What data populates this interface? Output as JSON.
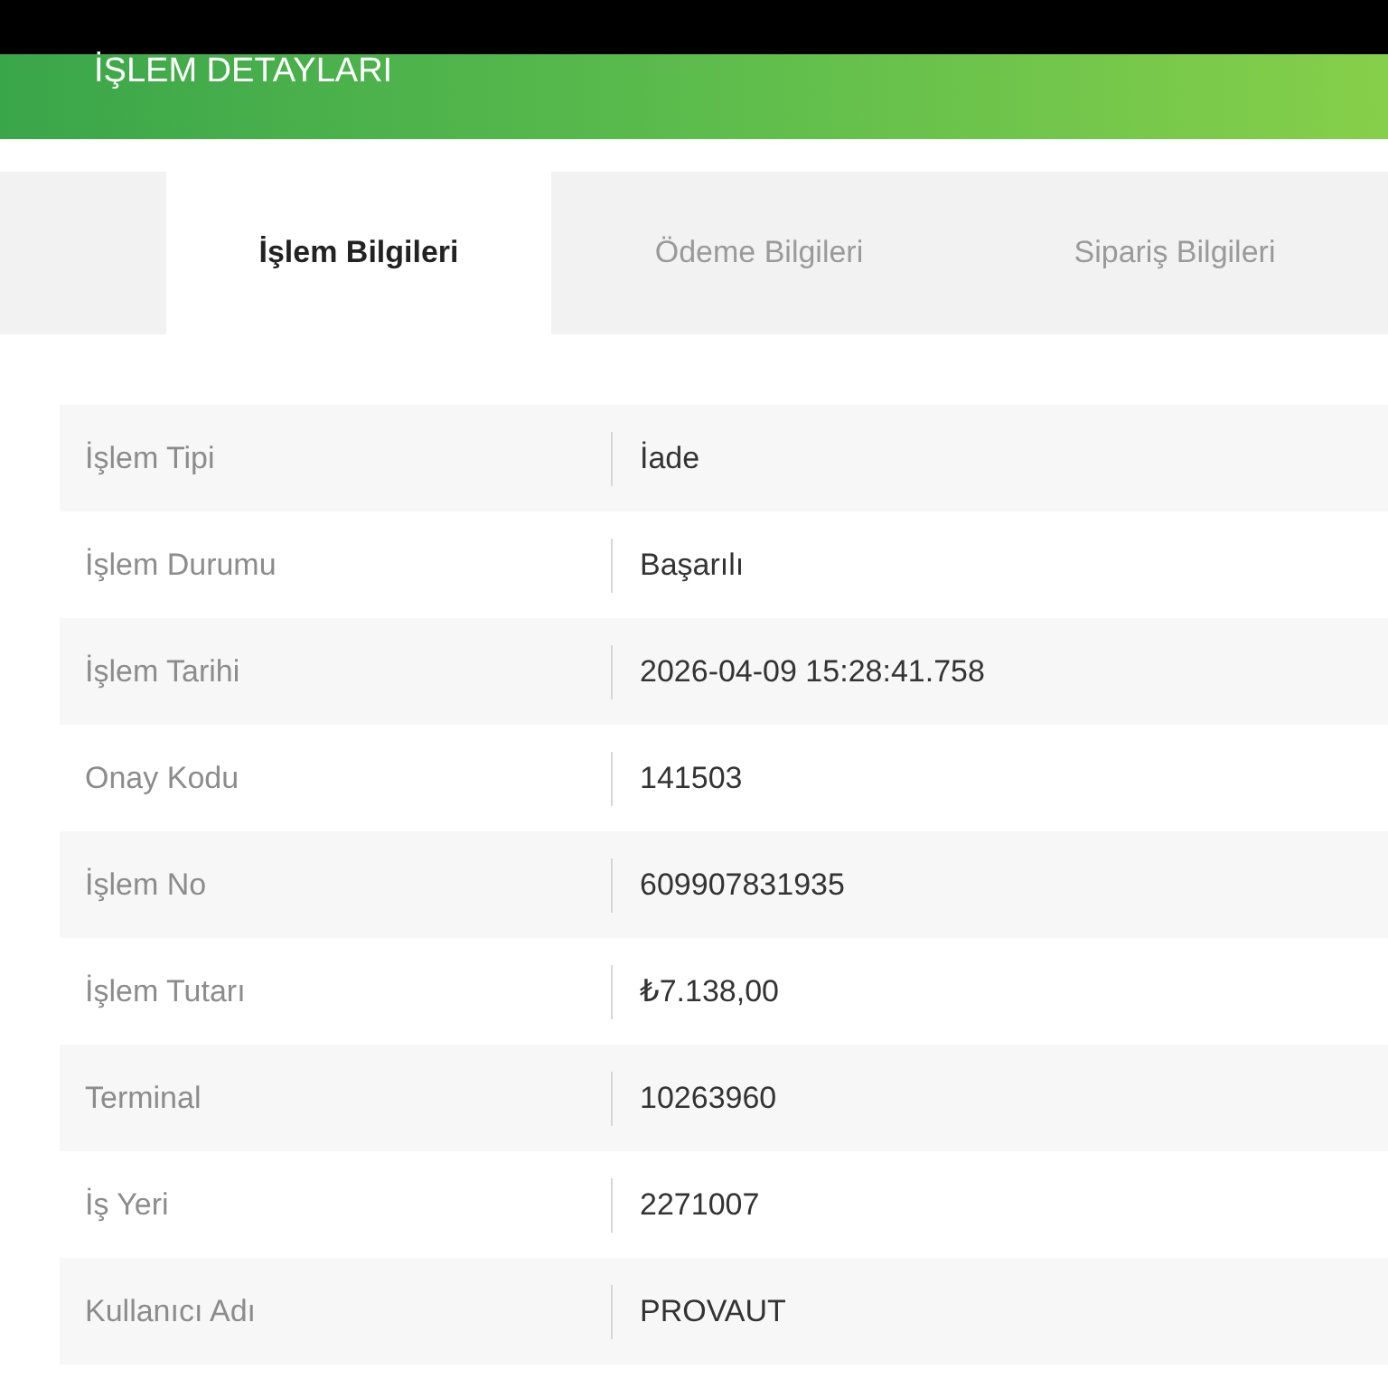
{
  "header": {
    "title": "İŞLEM DETAYLARI"
  },
  "tabs": [
    {
      "label": "İşlem Bilgileri",
      "selected": true
    },
    {
      "label": "Ödeme Bilgileri",
      "selected": false
    },
    {
      "label": "Sipariş Bilgileri",
      "selected": false
    }
  ],
  "details": [
    {
      "label": "İşlem Tipi",
      "value": "İade"
    },
    {
      "label": "İşlem Durumu",
      "value": "Başarılı"
    },
    {
      "label": "İşlem Tarihi",
      "value": "2026-04-09 15:28:41.758"
    },
    {
      "label": "Onay Kodu",
      "value": "141503"
    },
    {
      "label": "İşlem No",
      "value": "609907831935"
    },
    {
      "label": "İşlem Tutarı",
      "value": "₺7.138,00"
    },
    {
      "label": "Terminal",
      "value": "10263960"
    },
    {
      "label": "İş Yeri",
      "value": "2271007"
    },
    {
      "label": "Kullanıcı Adı",
      "value": "PROVAUT"
    }
  ]
}
